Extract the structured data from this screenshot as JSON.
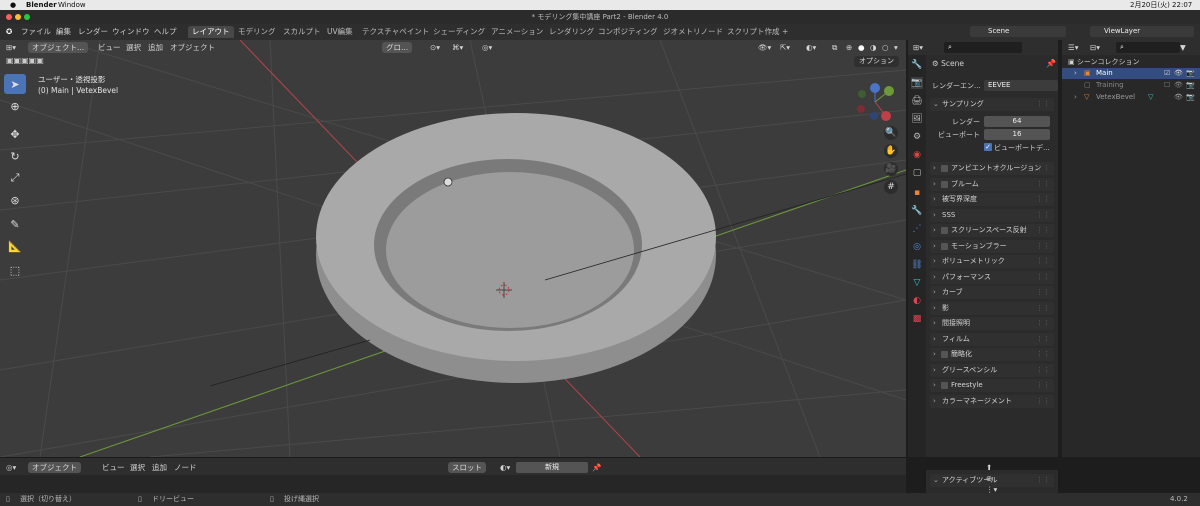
{
  "mac_menu": {
    "apple": "",
    "app": "Blender",
    "window": "Window",
    "datetime": "2月20日(火) 22:07"
  },
  "window_title": "* モデリング集中講座 Part2 - Blender 4.0",
  "menus": [
    "ファイル",
    "編集",
    "レンダー",
    "ウィンドウ",
    "ヘルプ"
  ],
  "workspace_tabs": [
    "レイアウト",
    "モデリング",
    "スカルプト",
    "UV編集",
    "テクスチャペイント",
    "シェーディング",
    "アニメーション",
    "レンダリング",
    "コンポジティング",
    "ジオメトリノード",
    "スクリプト作成"
  ],
  "active_tab": "レイアウト",
  "scene_field": "Scene",
  "view_layer_field": "ViewLayer",
  "viewport_header": {
    "mode": "オブジェクト...",
    "menus": [
      "ビュー",
      "選択",
      "追加",
      "オブジェクト"
    ],
    "transform": "グロ...",
    "options": "オプション"
  },
  "viewport_info": {
    "line1": "ユーザー・透視投影",
    "line2": "(0) Main | VetexBevel"
  },
  "properties": {
    "scene_name": "Scene",
    "render_engine_label": "レンダーエン...",
    "render_engine_value": "EEVEE",
    "sampling": {
      "title": "サンプリング",
      "render_label": "レンダー",
      "render_value": "64",
      "viewport_label": "ビューポート",
      "viewport_value": "16",
      "denoise_label": "ビューポートデ..."
    },
    "sections": [
      {
        "label": "アンビエントオクルージョン",
        "checkbox": true
      },
      {
        "label": "ブルーム",
        "checkbox": true
      },
      {
        "label": "被写界深度",
        "checkbox": false
      },
      {
        "label": "SSS",
        "checkbox": false
      },
      {
        "label": "スクリーンスペース反射",
        "checkbox": true
      },
      {
        "label": "モーションブラー",
        "checkbox": true
      },
      {
        "label": "ボリューメトリック",
        "checkbox": false
      },
      {
        "label": "パフォーマンス",
        "checkbox": false
      },
      {
        "label": "カーブ",
        "checkbox": false
      },
      {
        "label": "影",
        "checkbox": false
      },
      {
        "label": "間接照明",
        "checkbox": false
      },
      {
        "label": "フィルム",
        "checkbox": false
      },
      {
        "label": "簡略化",
        "checkbox": true
      },
      {
        "label": "グリースペンシル",
        "checkbox": false
      },
      {
        "label": "Freestyle",
        "checkbox": true
      },
      {
        "label": "カラーマネージメント",
        "checkbox": false
      }
    ],
    "active_tool": "アクティブツール"
  },
  "outliner": {
    "root": "シーンコレクション",
    "items": [
      "Main",
      "Training",
      "VetexBevel"
    ]
  },
  "footer": {
    "mode": "オブジェクト",
    "menus": [
      "ビュー",
      "選択",
      "追加",
      "ノード"
    ],
    "slot": "スロット",
    "new": "新規"
  },
  "status": {
    "select": "選択（切り替え）",
    "dolly": "ドリービュー",
    "lasso": "投げ縄選択",
    "version": "4.0.2"
  }
}
